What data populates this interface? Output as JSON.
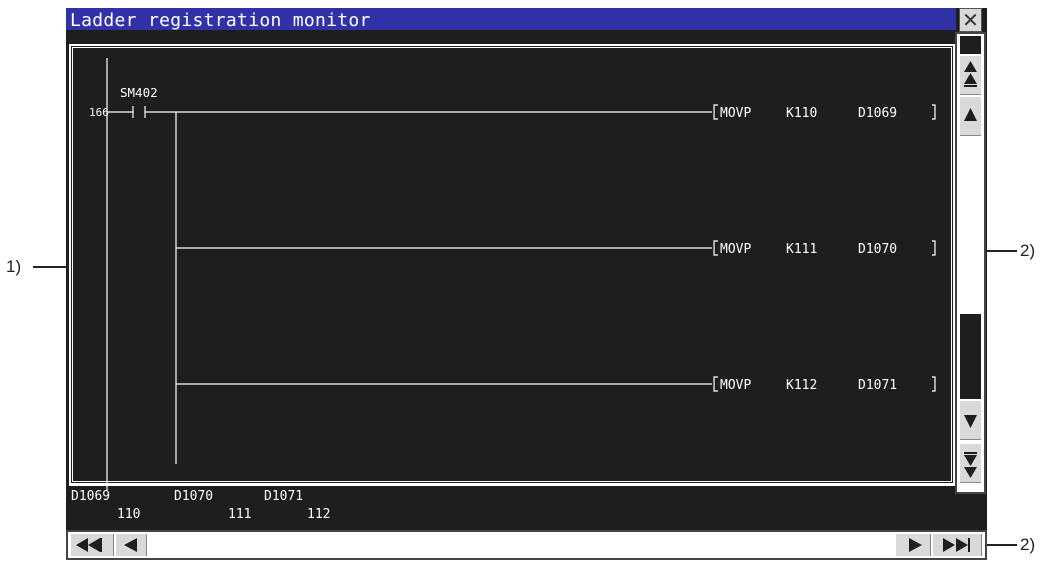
{
  "window": {
    "title": "Ladder registration monitor",
    "close_icon": "close-icon"
  },
  "ladder": {
    "step_number": "166",
    "contact_device": "SM402",
    "rungs": [
      {
        "instruction": "MOVP",
        "source": "K110",
        "destination": "D1069"
      },
      {
        "instruction": "MOVP",
        "source": "K111",
        "destination": "D1070"
      },
      {
        "instruction": "MOVP",
        "source": "K112",
        "destination": "D1071"
      }
    ]
  },
  "monitor": {
    "devices": [
      {
        "device": "D1069",
        "value": "110"
      },
      {
        "device": "D1070",
        "value": "111"
      },
      {
        "device": "D1071",
        "value": "112"
      }
    ]
  },
  "scroll": {
    "vertical_icons": [
      "page-up-icon",
      "line-up-icon",
      "line-down-icon",
      "page-down-icon"
    ],
    "horizontal_icons": [
      "page-left-icon",
      "line-left-icon",
      "line-right-icon",
      "page-right-icon"
    ]
  },
  "callouts": {
    "ladder_area": "1)",
    "vertical_scrollbar": "2)",
    "horizontal_scrollbar": "2)"
  },
  "colors": {
    "background": "#1e1e1e",
    "titlebar": "#3232a8",
    "ladder_line": "#ffffff",
    "scroll_button": "#d9d9d9"
  }
}
